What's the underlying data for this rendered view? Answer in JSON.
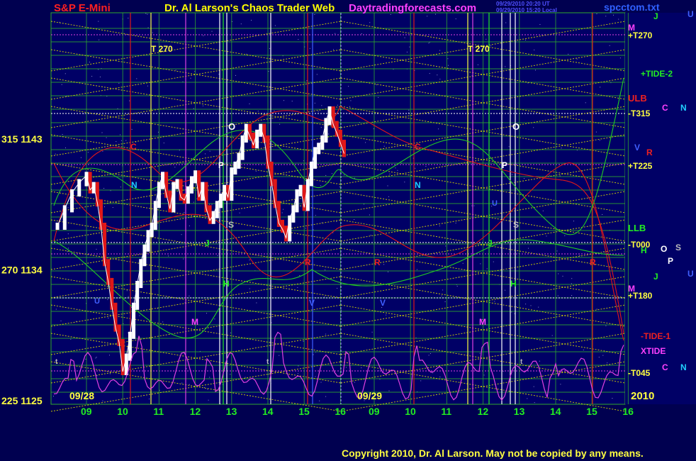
{
  "header": {
    "left_title": "S&P E-Mini",
    "center_title": "Dr. Al Larson's Chaos Trader Web",
    "site": "Daytradingforecasts.com",
    "stamp1": "09/29/2010 20:20 UT",
    "stamp2": "09/29/2010 15:20 Local",
    "file": "spcctom.txt"
  },
  "footer": {
    "copyright": "Copyright 2010, Dr. Al Larson. May not be copied by any means."
  },
  "colors": {
    "background": "#000050",
    "plot_bg": "#000066",
    "grid_green": "#2fa82f",
    "grid_yellow": "#d8d800",
    "magenta": "#e040e0",
    "red": "#e01818",
    "green_line": "#22cc22",
    "white": "#ffffff"
  },
  "chart_data": {
    "type": "line",
    "y_ticks": [
      {
        "value": 1143,
        "label": "315  1143"
      },
      {
        "value": 1134,
        "label": "270  1134"
      },
      {
        "value": 1125,
        "label": "225  1125"
      }
    ],
    "ylim": [
      1125,
      1145.3
    ],
    "days": [
      {
        "date_label": "09/28",
        "hours": [
          "09",
          "10",
          "11",
          "12",
          "13",
          "14",
          "15",
          "16"
        ]
      },
      {
        "date_label": "09/29",
        "hours": [
          "09",
          "10",
          "11",
          "12",
          "13",
          "14",
          "15",
          "16"
        ]
      }
    ],
    "year_label": "2010",
    "price_series": {
      "name": "",
      "hours_from_day1_09": [
        -0.8,
        -0.6,
        -0.4,
        -0.2,
        0.0,
        0.1,
        0.2,
        0.3,
        0.4,
        0.5,
        0.6,
        0.7,
        0.8,
        0.9,
        1.0,
        1.1,
        1.2,
        1.3,
        1.4,
        1.5,
        1.6,
        1.7,
        1.8,
        1.9,
        2.0,
        2.1,
        2.2,
        2.3,
        2.4,
        2.5,
        2.6,
        2.7,
        2.8,
        2.9,
        3.0,
        3.1,
        3.2,
        3.3,
        3.4,
        3.5,
        3.6,
        3.7,
        3.8,
        3.9,
        4.0,
        4.1,
        4.2,
        4.3,
        4.4,
        4.5,
        4.6,
        4.7,
        4.8,
        4.9,
        5.0,
        5.1,
        5.2,
        5.3,
        5.4,
        5.5,
        5.6,
        5.7,
        5.8,
        5.9,
        6.0,
        6.1,
        6.2,
        6.3,
        6.4,
        6.5,
        6.6,
        6.7,
        6.8,
        6.9,
        7.0,
        7.1
      ],
      "values": [
        1137.0,
        1138.2,
        1139.3,
        1140.0,
        1140.5,
        1139.5,
        1139.8,
        1138.6,
        1137.0,
        1134.5,
        1133.2,
        1131.5,
        1130.0,
        1129.0,
        1127.0,
        1128.0,
        1129.5,
        1131.5,
        1133.0,
        1134.5,
        1135.5,
        1136.5,
        1137.0,
        1138.5,
        1139.8,
        1140.5,
        1139.2,
        1138.2,
        1139.8,
        1140.0,
        1139.0,
        1138.8,
        1139.5,
        1140.2,
        1140.6,
        1139.0,
        1139.8,
        1138.2,
        1137.4,
        1137.8,
        1138.5,
        1139.0,
        1139.6,
        1139.0,
        1140.8,
        1141.2,
        1141.8,
        1143.0,
        1143.8,
        1143.2,
        1142.6,
        1143.4,
        1143.8,
        1143.0,
        1141.2,
        1140.0,
        1138.5,
        1137.2,
        1136.8,
        1136.2,
        1137.5,
        1138.2,
        1139.3,
        1139.6,
        1138.3,
        1140.0,
        1141.2,
        1142.2,
        1142.5,
        1143.0,
        1144.2,
        1145.0,
        1144.0,
        1143.4,
        1142.7,
        1142.0
      ]
    }
  },
  "labels": {
    "T270_a": "T  270",
    "T270_b": "T  270",
    "plus_T270": "+T270",
    "plus_TIDE2": "+TIDE-2",
    "ULB": "ULB",
    "minus_T315": "-T315",
    "plus_T225": "+T225",
    "LLB": "LLB",
    "minus_T000": "-T000",
    "plus_T180": "+T180",
    "minus_TIDE1": "-TIDE-1",
    "XTIDE": "XTIDE",
    "minus_T045": "-T045",
    "marker_C": "C",
    "marker_N": "N",
    "marker_V": "V",
    "marker_R": "R",
    "marker_H": "H",
    "marker_O": "O",
    "marker_S": "S",
    "marker_P": "P",
    "marker_J": "J",
    "marker_U": "U",
    "marker_M": "M",
    "marker_t": "t"
  }
}
